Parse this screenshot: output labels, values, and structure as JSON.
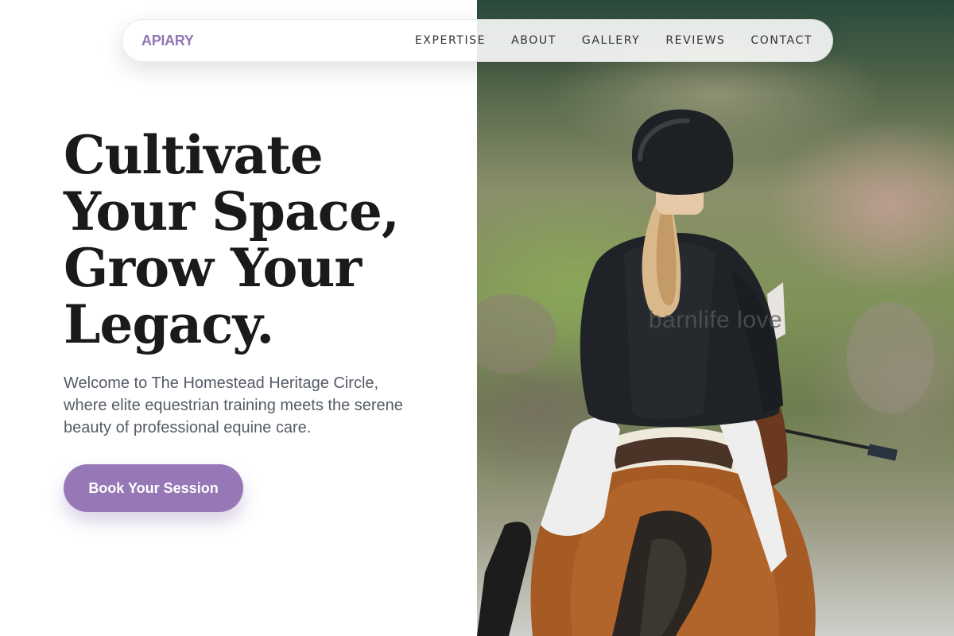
{
  "nav": {
    "brand": "APIARY",
    "links": [
      "EXPERTISE",
      "ABOUT",
      "GALLERY",
      "REVIEWS",
      "CONTACT"
    ]
  },
  "hero": {
    "title_lines": [
      "Cultivate",
      "Your Space,",
      "Grow Your",
      "Legacy."
    ],
    "subtitle": "Welcome to The Homestead Heritage Circle, where elite equestrian training meets the serene beauty of professional equine care.",
    "cta_label": "Book Your Session",
    "image_caption": "barnlife love"
  },
  "colors": {
    "accent": "#9678b7",
    "brand": "#9175b4",
    "heading": "#1a1a1a",
    "body_text": "#555b66"
  }
}
